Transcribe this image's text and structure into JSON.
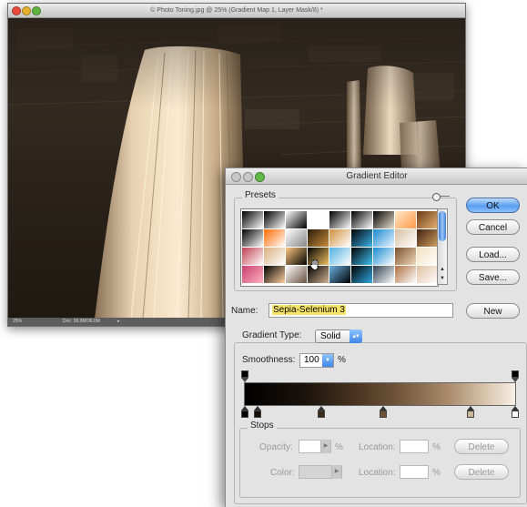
{
  "document": {
    "title": "© Photo Toning.jpg @ 25% (Gradient Map 1, Layer Mask/8) *",
    "status_zoom": "25%",
    "status_doc": "Doc: 36.0M/36.0M"
  },
  "dialog": {
    "title": "Gradient Editor",
    "presets_label": "Presets",
    "buttons": {
      "ok": "OK",
      "cancel": "Cancel",
      "load": "Load...",
      "save": "Save...",
      "new": "New"
    },
    "name_label": "Name:",
    "name_value": "Sepia-Selenium 3",
    "gradient_type_label": "Gradient Type:",
    "gradient_type_value": "Solid",
    "smoothness_label": "Smoothness:",
    "smoothness_value": "100",
    "percent": "%",
    "stops_label": "Stops",
    "opacity_label": "Opacity:",
    "color_label": "Color:",
    "location_label": "Location:",
    "delete_label": "Delete"
  },
  "colors": {
    "ok_button": "#5a9ef0",
    "name_highlight": "#f6e46a",
    "scroll_thumb": "#3f7fd6"
  },
  "icons": {
    "window_controls": [
      "close-dot",
      "minimize-dot",
      "zoom-dot"
    ],
    "presets_menu": "gear-dot-icon",
    "popup_arrow": "updown-arrow-icon",
    "cursor": "hand-cursor-icon"
  }
}
